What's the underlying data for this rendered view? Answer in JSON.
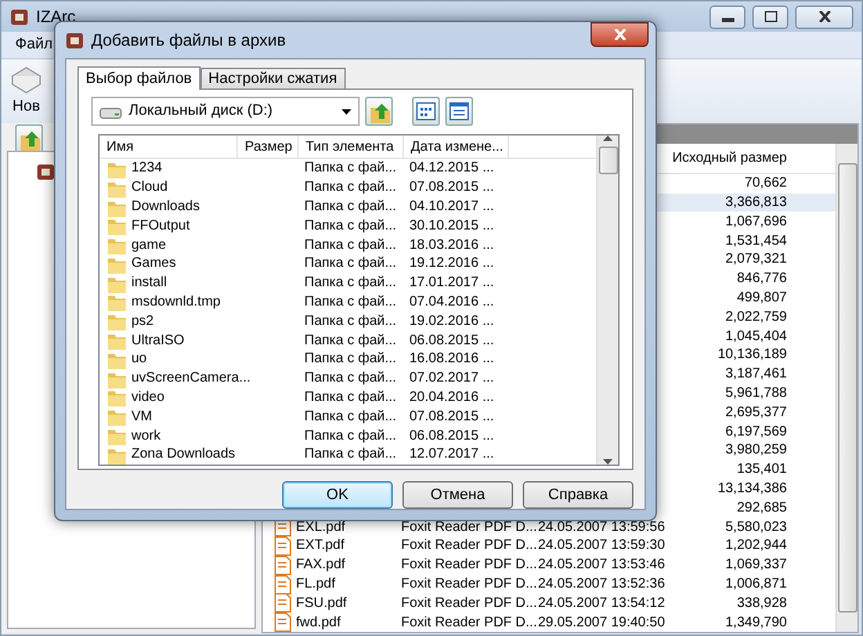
{
  "main_window": {
    "title": "IZArc",
    "menu": [
      "Файл"
    ],
    "toolbar": [
      {
        "label": "Нов"
      }
    ],
    "file_list": {
      "columns": [
        "Исходный размер"
      ],
      "rows": [
        {
          "original_size": "70,662",
          "selected": false
        },
        {
          "original_size": "3,366,813",
          "selected": true
        },
        {
          "original_size": "1,067,696",
          "selected": false
        },
        {
          "original_size": "1,531,454",
          "selected": false
        },
        {
          "original_size": "2,079,321",
          "selected": false
        },
        {
          "original_size": "846,776",
          "selected": false
        },
        {
          "original_size": "499,807",
          "selected": false
        },
        {
          "original_size": "2,022,759",
          "selected": false
        },
        {
          "original_size": "1,045,404",
          "selected": false
        },
        {
          "original_size": "10,136,189",
          "selected": false
        },
        {
          "original_size": "3,187,461",
          "selected": false
        },
        {
          "original_size": "5,961,788",
          "selected": false
        },
        {
          "original_size": "2,695,377",
          "selected": false
        },
        {
          "original_size": "6,197,569",
          "selected": false
        },
        {
          "original_size": "3,980,259",
          "selected": false
        },
        {
          "original_size": "135,401",
          "selected": false
        },
        {
          "original_size": "13,134,386",
          "selected": false
        },
        {
          "original_size": "292,685",
          "selected": false
        },
        {
          "name": "EXL.pdf",
          "type": "Foxit Reader PDF D...",
          "modified": "24.05.2007 13:59:56",
          "original_size": "5,580,023",
          "selected": false
        },
        {
          "name": "EXT.pdf",
          "type": "Foxit Reader PDF D...",
          "modified": "24.05.2007 13:59:30",
          "original_size": "1,202,944",
          "selected": false
        },
        {
          "name": "FAX.pdf",
          "type": "Foxit Reader PDF D...",
          "modified": "24.05.2007 13:53:46",
          "original_size": "1,069,337",
          "selected": false
        },
        {
          "name": "FL.pdf",
          "type": "Foxit Reader PDF D...",
          "modified": "24.05.2007 13:52:36",
          "original_size": "1,006,871",
          "selected": false
        },
        {
          "name": "FSU.pdf",
          "type": "Foxit Reader PDF D...",
          "modified": "24.05.2007 13:54:12",
          "original_size": "338,928",
          "selected": false
        },
        {
          "name": "fwd.pdf",
          "type": "Foxit Reader PDF D...",
          "modified": "29.05.2007 19:40:50",
          "original_size": "1,349,790",
          "selected": false
        }
      ]
    }
  },
  "dialog": {
    "title": "Добавить файлы в архив",
    "tabs": [
      {
        "label": "Выбор файлов",
        "selected": true
      },
      {
        "label": "Настройки сжатия",
        "selected": false
      }
    ],
    "location": {
      "value": "Локальный диск (D:)"
    },
    "file_list": {
      "columns": [
        "Имя",
        "Размер",
        "Тип элемента",
        "Дата измене..."
      ],
      "rows": [
        {
          "name": "1234",
          "type": "Папка с фай...",
          "modified": "04.12.2015 ..."
        },
        {
          "name": "Cloud",
          "type": "Папка с фай...",
          "modified": "07.08.2015 ..."
        },
        {
          "name": "Downloads",
          "type": "Папка с фай...",
          "modified": "04.10.2017 ..."
        },
        {
          "name": "FFOutput",
          "type": "Папка с фай...",
          "modified": "30.10.2015 ..."
        },
        {
          "name": "game",
          "type": "Папка с фай...",
          "modified": "18.03.2016 ..."
        },
        {
          "name": "Games",
          "type": "Папка с фай...",
          "modified": "19.12.2016 ..."
        },
        {
          "name": "install",
          "type": "Папка с фай...",
          "modified": "17.01.2017 ..."
        },
        {
          "name": "msdownld.tmp",
          "type": "Папка с фай...",
          "modified": "07.04.2016 ..."
        },
        {
          "name": "ps2",
          "type": "Папка с фай...",
          "modified": "19.02.2016 ..."
        },
        {
          "name": "UltraISO",
          "type": "Папка с фай...",
          "modified": "06.08.2015 ..."
        },
        {
          "name": "uo",
          "type": "Папка с фай...",
          "modified": "16.08.2016 ..."
        },
        {
          "name": "uvScreenCamera...",
          "type": "Папка с фай...",
          "modified": "07.02.2017 ..."
        },
        {
          "name": "video",
          "type": "Папка с фай...",
          "modified": "20.04.2016 ..."
        },
        {
          "name": "VM",
          "type": "Папка с фай...",
          "modified": "07.08.2015 ..."
        },
        {
          "name": "work",
          "type": "Папка с фай...",
          "modified": "06.08.2015 ..."
        },
        {
          "name": "Zona Downloads",
          "type": "Папка с фай...",
          "modified": "12.07.2017 ..."
        }
      ]
    },
    "buttons": [
      {
        "label": "OK",
        "default": true
      },
      {
        "label": "Отмена",
        "default": false
      },
      {
        "label": "Справка",
        "default": false
      }
    ]
  }
}
